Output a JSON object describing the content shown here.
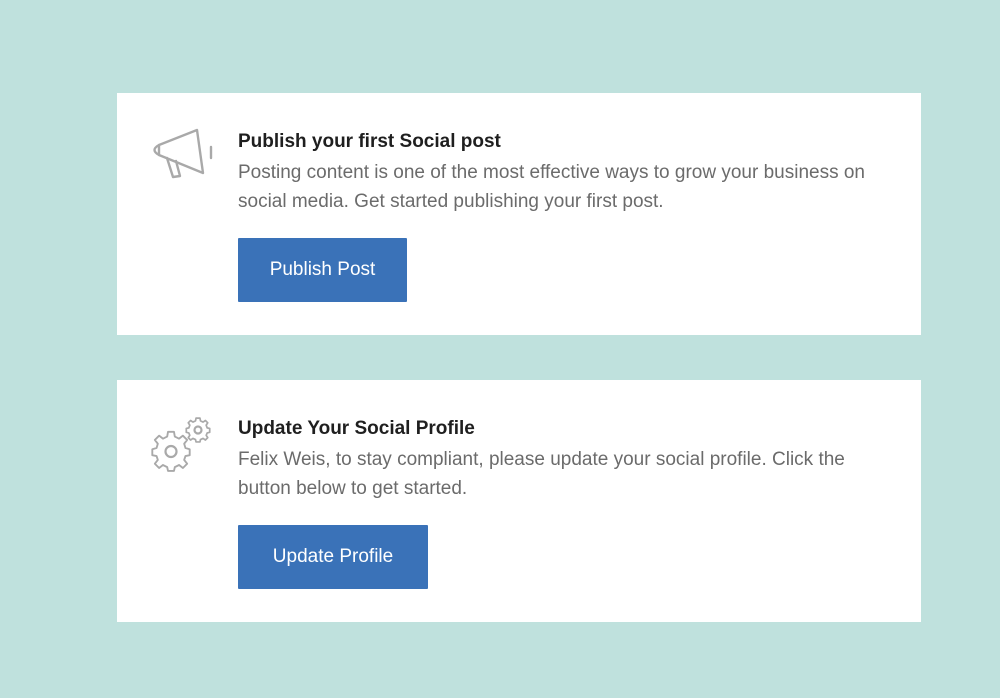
{
  "colors": {
    "background": "#bfe1dd",
    "card": "#ffffff",
    "button": "#3a72b8",
    "title": "#1f1f1f",
    "description": "#6b6b6b",
    "icon": "#a9a9a9"
  },
  "cards": [
    {
      "icon": "megaphone-icon",
      "title": "Publish your first Social post",
      "description": "Posting content is one of the most effective ways to grow your business on social media. Get started publishing your first post.",
      "button_label": "Publish Post"
    },
    {
      "icon": "gears-icon",
      "title": "Update Your Social Profile",
      "description": "Felix Weis, to stay compliant, please update your social profile. Click the button below to get started.",
      "button_label": "Update Profile"
    }
  ]
}
